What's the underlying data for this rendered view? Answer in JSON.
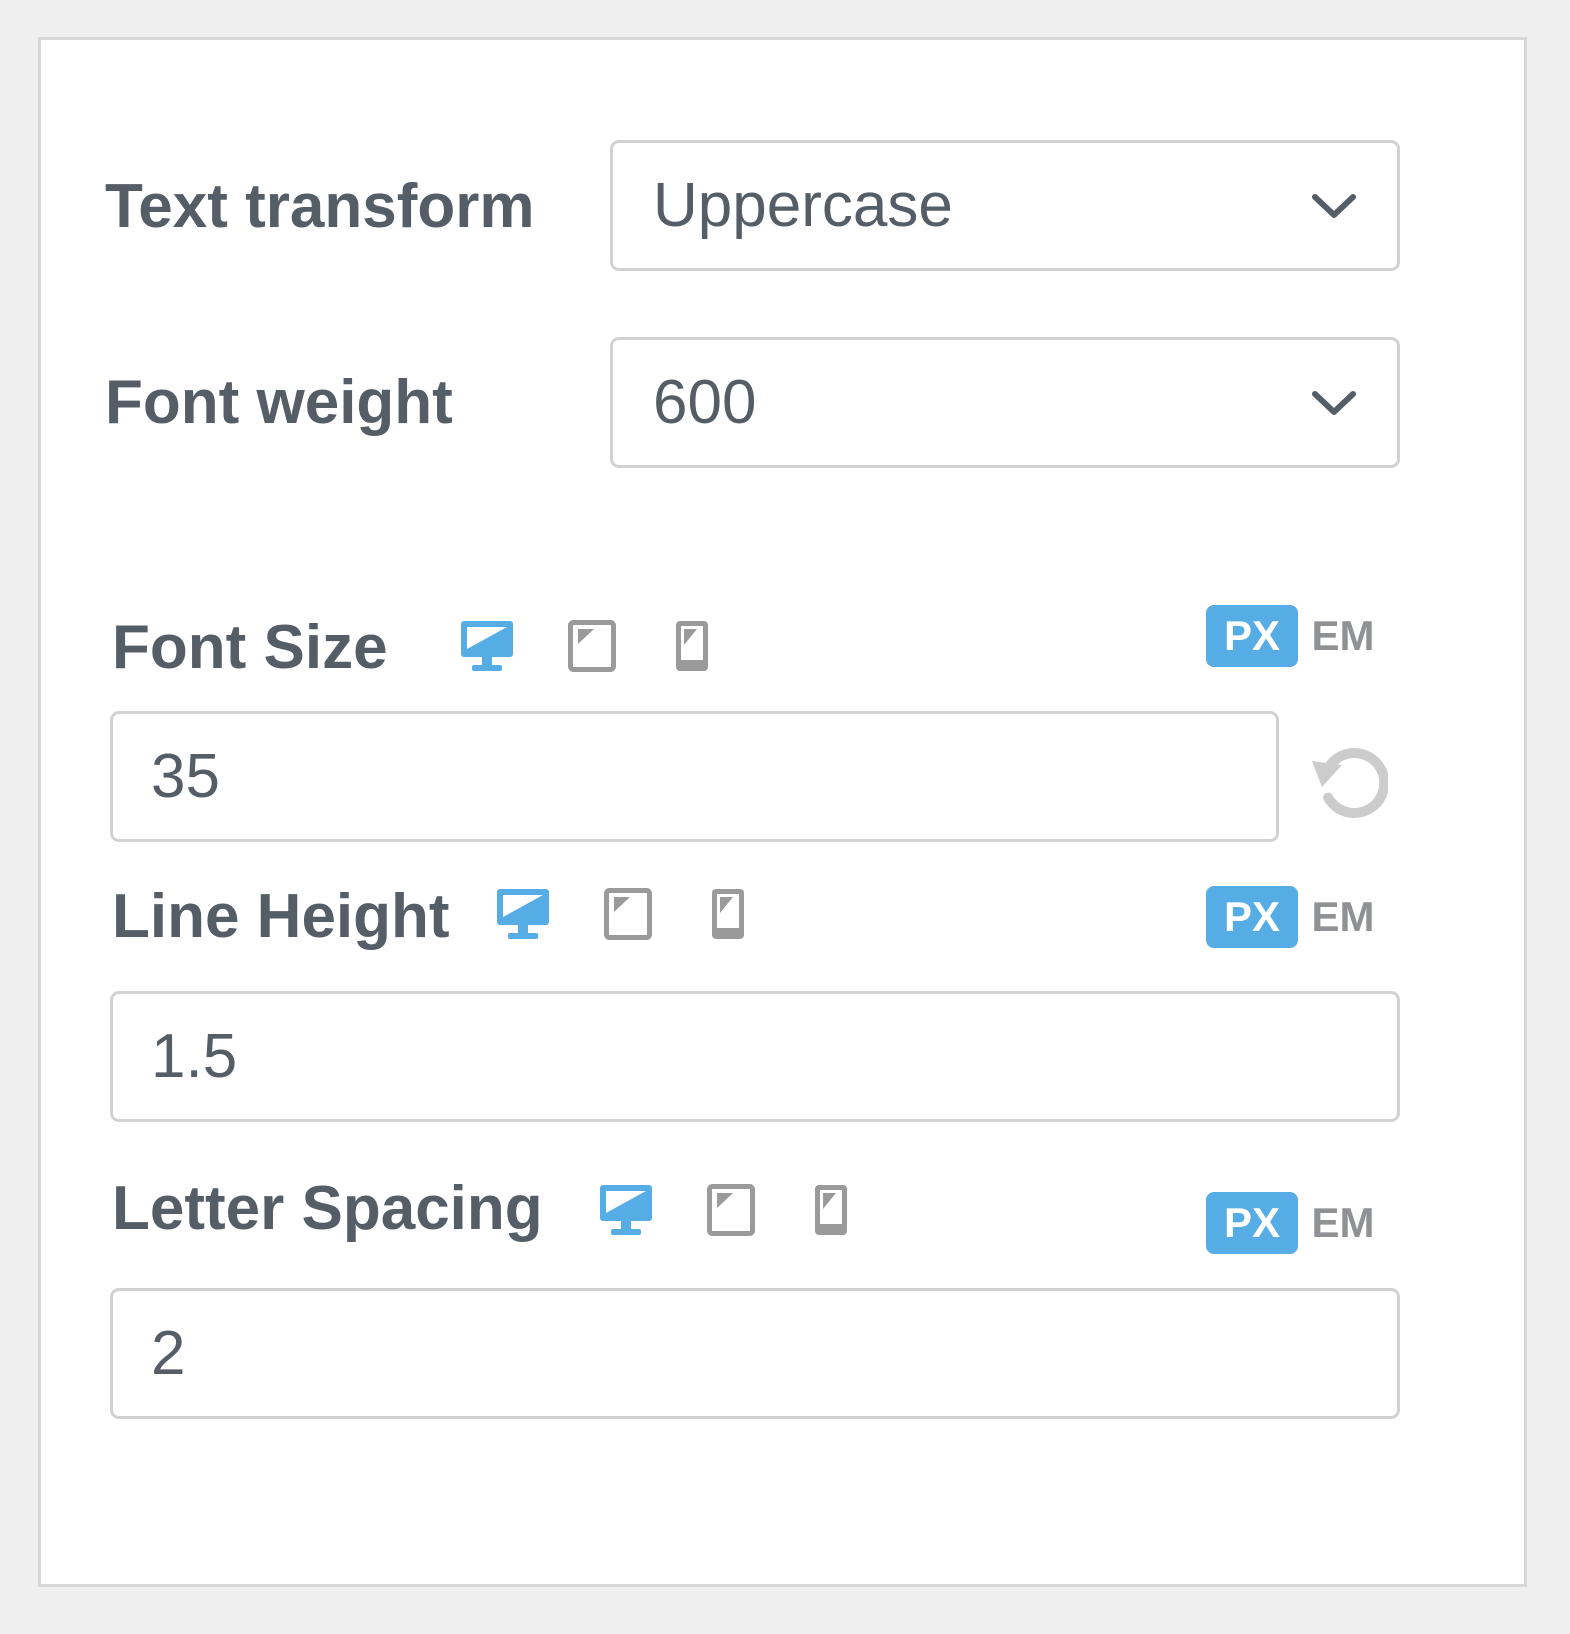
{
  "text_transform": {
    "label": "Text transform",
    "value": "Uppercase",
    "icon": "chevron-down-icon"
  },
  "font_weight": {
    "label": "Font weight",
    "value": "600",
    "icon": "chevron-down-icon"
  },
  "font_size": {
    "label": "Font Size",
    "value": "35",
    "units": {
      "px": "PX",
      "em": "EM",
      "selected": "PX"
    },
    "devices": [
      "desktop-icon",
      "tablet-icon",
      "mobile-icon"
    ],
    "active_device": "desktop",
    "reset_icon": "reset-icon"
  },
  "line_height": {
    "label": "Line Height",
    "value": "1.5",
    "units": {
      "px": "PX",
      "em": "EM",
      "selected": "PX"
    },
    "devices": [
      "desktop-icon",
      "tablet-icon",
      "mobile-icon"
    ],
    "active_device": "desktop"
  },
  "letter_spacing": {
    "label": "Letter Spacing",
    "value": "2",
    "units": {
      "px": "PX",
      "em": "EM",
      "selected": "PX"
    },
    "devices": [
      "desktop-icon",
      "tablet-icon",
      "mobile-icon"
    ],
    "active_device": "desktop"
  },
  "colors": {
    "accent": "#56ace4",
    "text": "#555d66",
    "muted": "#8f9194",
    "border": "#d2d2d2",
    "background": "#efefef"
  }
}
